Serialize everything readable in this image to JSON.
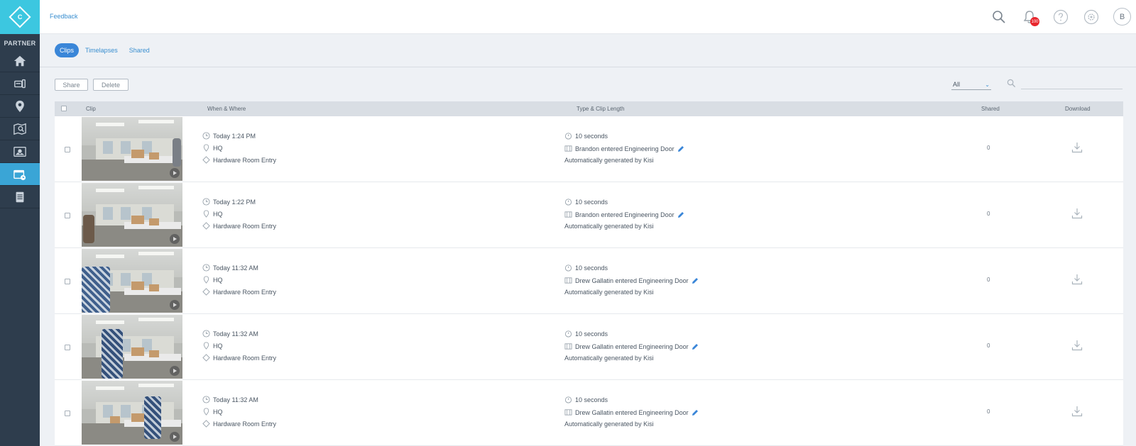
{
  "sidebar": {
    "logo_letter": "C",
    "partner_label": "PARTNER",
    "items": [
      {
        "name": "home",
        "icon": "home-icon",
        "active": false
      },
      {
        "name": "devices",
        "icon": "devices-icon",
        "active": false
      },
      {
        "name": "places",
        "icon": "location-pin-icon",
        "active": false
      },
      {
        "name": "maps",
        "icon": "map-search-icon",
        "active": false
      },
      {
        "name": "cameras",
        "icon": "photo-icon",
        "active": false
      },
      {
        "name": "clips",
        "icon": "video-clip-icon",
        "active": true
      },
      {
        "name": "logs",
        "icon": "document-icon",
        "active": false
      }
    ]
  },
  "header": {
    "feedback_label": "Feedback",
    "notification_count": "100",
    "avatar_initial": "B"
  },
  "tabs": [
    {
      "label": "Clips",
      "active": true
    },
    {
      "label": "Timelapses",
      "active": false
    },
    {
      "label": "Shared",
      "active": false
    }
  ],
  "toolbar": {
    "share_label": "Share",
    "delete_label": "Delete",
    "filter_value": "All",
    "search_placeholder": ""
  },
  "table": {
    "columns": {
      "clip": "Clip",
      "when_where": "When & Where",
      "type_length": "Type & Clip Length",
      "shared": "Shared",
      "download": "Download"
    },
    "rows": [
      {
        "time": "Today 1:24 PM",
        "place": "HQ",
        "door": "Hardware Room Entry",
        "length": "10 seconds",
        "event": "Brandon entered Engineering Door",
        "generated": "Automatically generated by Kisi",
        "shared": "0"
      },
      {
        "time": "Today 1:22 PM",
        "place": "HQ",
        "door": "Hardware Room Entry",
        "length": "10 seconds",
        "event": "Brandon entered Engineering Door",
        "generated": "Automatically generated by Kisi",
        "shared": "0"
      },
      {
        "time": "Today 11:32 AM",
        "place": "HQ",
        "door": "Hardware Room Entry",
        "length": "10 seconds",
        "event": "Drew Gallatin entered Engineering Door",
        "generated": "Automatically generated by Kisi",
        "shared": "0"
      },
      {
        "time": "Today 11:32 AM",
        "place": "HQ",
        "door": "Hardware Room Entry",
        "length": "10 seconds",
        "event": "Drew Gallatin entered Engineering Door",
        "generated": "Automatically generated by Kisi",
        "shared": "0"
      },
      {
        "time": "Today 11:32 AM",
        "place": "HQ",
        "door": "Hardware Room Entry",
        "length": "10 seconds",
        "event": "Drew Gallatin entered Engineering Door",
        "generated": "Automatically generated by Kisi",
        "shared": "0"
      }
    ]
  },
  "colors": {
    "accent": "#3a86d8",
    "sidebar_bg": "#2e3d4d",
    "logo_bg": "#3cc7e0",
    "badge": "#e8262d"
  }
}
